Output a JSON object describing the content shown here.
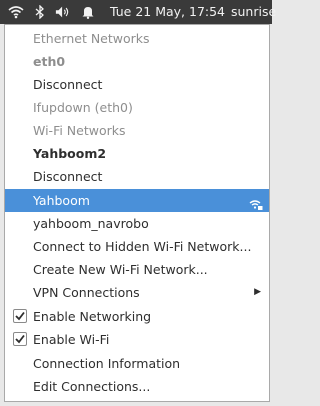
{
  "topbar": {
    "clock": "Tue 21 May, 17:54",
    "user": "sunrise",
    "icons": [
      "wifi-icon",
      "bluetooth-icon",
      "volume-icon",
      "notification-bell-icon"
    ]
  },
  "menu": {
    "ethernet_header": "Ethernet Networks",
    "eth_device": "eth0",
    "eth_disconnect": "Disconnect",
    "eth_profile": "Ifupdown (eth0)",
    "wifi_header": "Wi-Fi Networks",
    "wifi_active": "Yahboom2",
    "wifi_disconnect": "Disconnect",
    "networks": [
      "Yahboom",
      "yahboom_navrobo"
    ],
    "hidden_network": "Connect to Hidden Wi-Fi Network...",
    "new_network": "Create New Wi-Fi Network...",
    "vpn": "VPN Connections",
    "enable_networking": "Enable Networking",
    "enable_wifi": "Enable Wi-Fi",
    "connection_info": "Connection Information",
    "edit_connections": "Edit Connections..."
  },
  "state": {
    "enable_networking_checked": true,
    "enable_wifi_checked": true,
    "highlighted_item": "Yahboom"
  },
  "colors": {
    "topbar_bg": "#3a3a3a",
    "highlight": "#4a90d9",
    "disabled_text": "#8e8e8e"
  }
}
